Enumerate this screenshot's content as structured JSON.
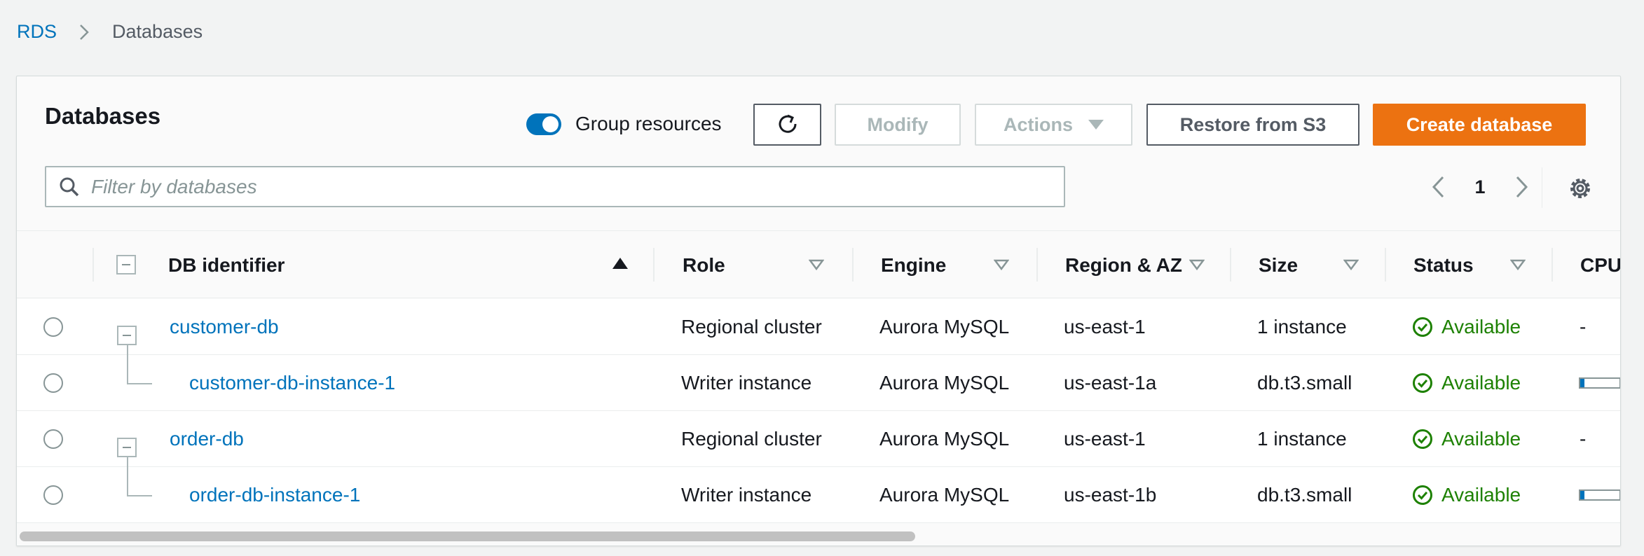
{
  "breadcrumb": {
    "root": "RDS",
    "current": "Databases"
  },
  "panel": {
    "title": "Databases",
    "group_resources_label": "Group resources",
    "group_resources_on": true,
    "buttons": {
      "modify": "Modify",
      "actions": "Actions",
      "restore": "Restore from S3",
      "create": "Create database"
    },
    "search": {
      "placeholder": "Filter by databases",
      "value": ""
    },
    "pagination": {
      "page": "1"
    }
  },
  "table": {
    "columns": [
      "DB identifier",
      "Role",
      "Engine",
      "Region & AZ",
      "Size",
      "Status",
      "CPU"
    ],
    "rows": [
      {
        "id": "customer-db",
        "role": "Regional cluster",
        "engine": "Aurora MySQL",
        "region": "us-east-1",
        "size": "1 instance",
        "status": "Available",
        "cpu": "-"
      },
      {
        "id": "customer-db-instance-1",
        "role": "Writer instance",
        "engine": "Aurora MySQL",
        "region": "us-east-1a",
        "size": "db.t3.small",
        "status": "Available",
        "cpu_fraction": 0.1
      },
      {
        "id": "order-db",
        "role": "Regional cluster",
        "engine": "Aurora MySQL",
        "region": "us-east-1",
        "size": "1 instance",
        "status": "Available",
        "cpu": "-"
      },
      {
        "id": "order-db-instance-1",
        "role": "Writer instance",
        "engine": "Aurora MySQL",
        "region": "us-east-1b",
        "size": "db.t3.small",
        "status": "Available",
        "cpu_fraction": 0.1
      }
    ]
  },
  "colors": {
    "link": "#0073bb",
    "primary_button": "#ec7211",
    "success": "#1d8102",
    "toggle_on": "#0073bb"
  }
}
